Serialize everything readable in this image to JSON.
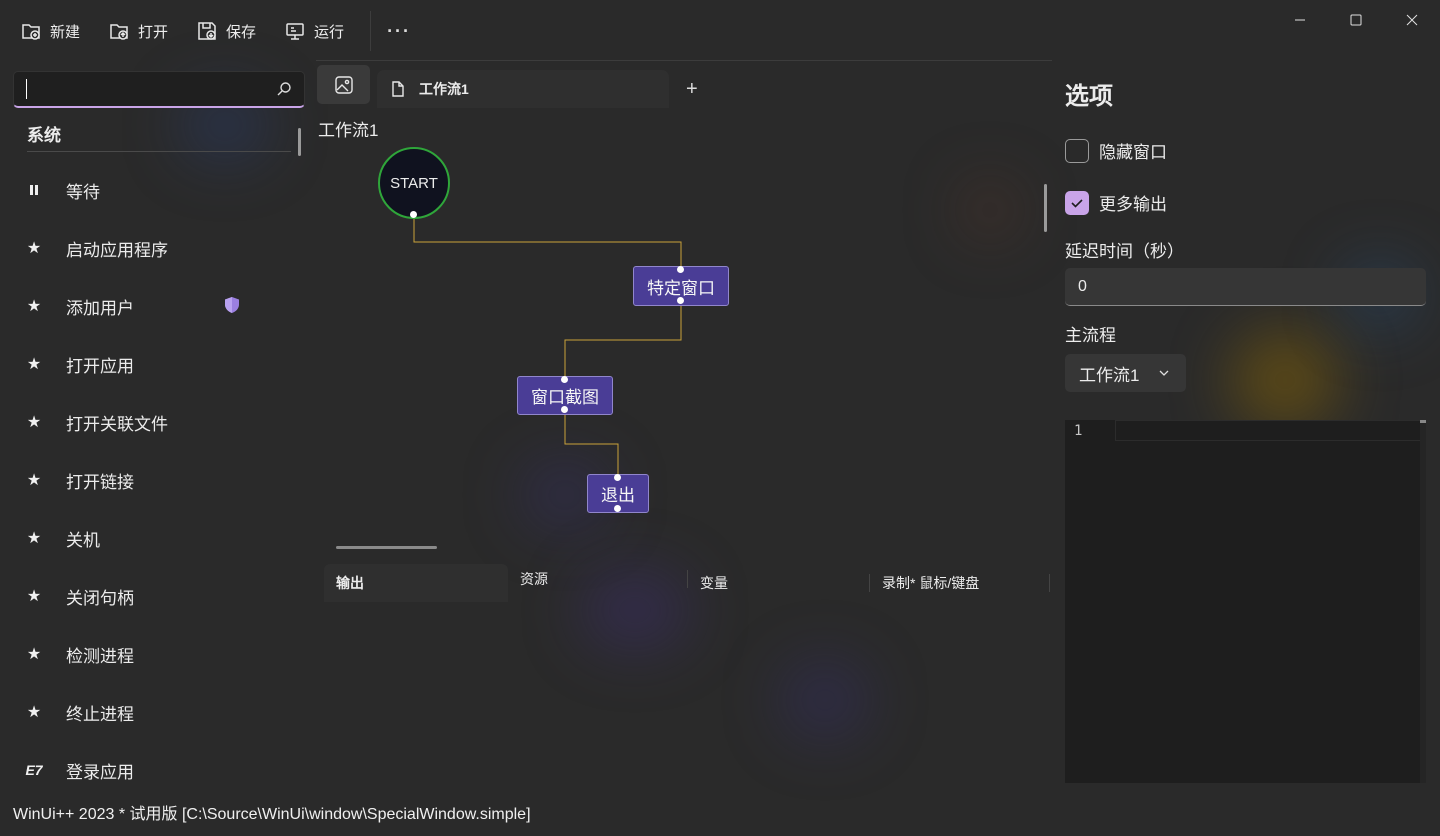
{
  "toolbar": {
    "buttons": [
      {
        "label": "新建",
        "icon": "new-file-icon"
      },
      {
        "label": "打开",
        "icon": "open-file-icon"
      },
      {
        "label": "保存",
        "icon": "save-file-icon"
      },
      {
        "label": "运行",
        "icon": "run-icon"
      }
    ],
    "more": "···"
  },
  "sidebar": {
    "search_value": "",
    "category": "系统",
    "items": [
      {
        "label": "等待",
        "icon": "pause-icon"
      },
      {
        "label": "启动应用程序",
        "icon": "star-icon"
      },
      {
        "label": "添加用户",
        "icon": "star-icon",
        "badge": "shield-icon"
      },
      {
        "label": "打开应用",
        "icon": "star-icon"
      },
      {
        "label": "打开关联文件",
        "icon": "star-icon"
      },
      {
        "label": "打开链接",
        "icon": "star-icon"
      },
      {
        "label": "关机",
        "icon": "star-icon"
      },
      {
        "label": "关闭句柄",
        "icon": "star-icon"
      },
      {
        "label": "检测进程",
        "icon": "star-icon"
      },
      {
        "label": "终止进程",
        "icon": "star-icon"
      },
      {
        "label": "登录应用",
        "icon": "e7-icon"
      }
    ]
  },
  "editor_tabs": {
    "active_tab": "工作流1",
    "add_symbol": "+"
  },
  "canvas": {
    "workflow_title": "工作流1",
    "nodes": {
      "start": "START",
      "special_window": "特定窗口",
      "screenshot": "窗口截图",
      "exit": "退出"
    }
  },
  "output_panel": {
    "tabs": [
      "输出",
      "资源",
      "变量",
      "录制* 鼠标/键盘"
    ],
    "active": "输出"
  },
  "options": {
    "title": "选项",
    "hide_window": {
      "label": "隐藏窗口",
      "checked": false
    },
    "more_output": {
      "label": "更多输出",
      "checked": true
    },
    "delay_label": "延迟时间（秒）",
    "delay_value": "0",
    "main_flow_label": "主流程",
    "main_flow_value": "工作流1",
    "code_line": "1"
  },
  "status_bar": "WinUi++ 2023 * 试用版 [C:\\Source\\WinUi\\window\\SpecialWindow.simple]",
  "colors": {
    "background": "#2a2a2a",
    "accent": "#c9a4e8",
    "node_fill": "#4a3d96",
    "start_border": "#2fa63a",
    "connector": "#c9a23a"
  }
}
